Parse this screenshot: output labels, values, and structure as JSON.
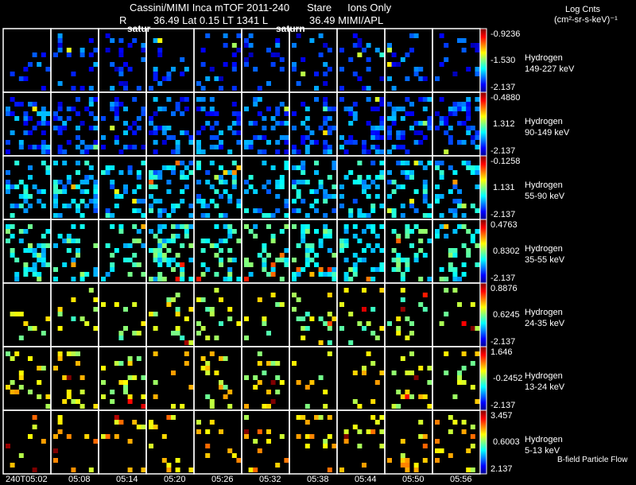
{
  "header": {
    "line1": "Cassini/MIMI Inca mTOF  2011-240    Stare    Ions Only",
    "line1_parts": [
      "Cassini/MIMI Inca mTOF  2011-240",
      "Stare",
      "Ions Only"
    ],
    "line2_R": "R",
    "line2_mid": "36.49 Lat 0.15 LT 1341 L",
    "line2_right": "36.49  MIMI/APL",
    "units_line1": "Log Cnts",
    "units_line2": "(cm²-sr-s-keV)⁻¹"
  },
  "overlay_labels": [
    "satur",
    "saturn"
  ],
  "footer_note": "B-field Particle Flow",
  "chart_data": {
    "type": "heatmap",
    "colormap": "jet",
    "x_tick_labels": [
      "240T05:02",
      "05:08",
      "05:14",
      "05:20",
      "05:26",
      "05:32",
      "05:38",
      "05:44",
      "05:50",
      "05:56"
    ],
    "rows": [
      {
        "species": "Hydrogen",
        "energy": "149-227 keV",
        "cb_max": "-0.9236",
        "cb_mid": "-1.530",
        "cb_min": "-2.137"
      },
      {
        "species": "Hydrogen",
        "energy": "90-149 keV",
        "cb_max": "-0.4880",
        "cb_mid": "1.312",
        "cb_min": "-2.137"
      },
      {
        "species": "Hydrogen",
        "energy": "55-90 keV",
        "cb_max": "-0.1258",
        "cb_mid": "1.131",
        "cb_min": "-2.137"
      },
      {
        "species": "Hydrogen",
        "energy": "35-55 keV",
        "cb_max": "0.4763",
        "cb_mid": "0.8302",
        "cb_min": "-2.137"
      },
      {
        "species": "Hydrogen",
        "energy": "24-35 keV",
        "cb_max": "0.8876",
        "cb_mid": "0.6245",
        "cb_min": "-2.137"
      },
      {
        "species": "Hydrogen",
        "energy": "13-24 keV",
        "cb_max": "1.646",
        "cb_mid": "-0.2452",
        "cb_min": "-2.137"
      },
      {
        "species": "Hydrogen",
        "energy": "5-13 keV",
        "cb_max": "3.457",
        "cb_mid": "0.6003",
        "cb_min": "2.137"
      }
    ]
  }
}
